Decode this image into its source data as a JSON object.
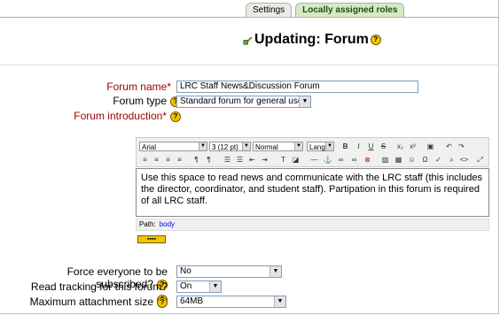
{
  "tabs": [
    {
      "label": "Settings"
    },
    {
      "label": "Locally assigned roles"
    }
  ],
  "page_title": "Updating: Forum",
  "help_glyph": "?",
  "form": {
    "forum_name_label": "Forum name*",
    "forum_name_value": "LRC Staff News&Discussion Forum",
    "forum_type_label": "Forum type",
    "forum_type_value": "Standard forum for general use",
    "forum_intro_label": "Forum introduction*",
    "intro_text": "Use this space to read news and communicate with the LRC staff (this includes the director, coordinator, and student staff). Partipation in this forum is required of all LRC staff.",
    "force_label": "Force everyone to be subscribed?",
    "force_value": "No",
    "tracking_label": "Read tracking for this forum?",
    "tracking_value": "On",
    "attach_label": "Maximum attachment size",
    "attach_value": "64MB"
  },
  "editor": {
    "font_family": "Arial",
    "font_size": "3 (12 pt)",
    "format": "Normal",
    "lang": "Lang",
    "path_label": "Path:",
    "path_value": "body"
  }
}
